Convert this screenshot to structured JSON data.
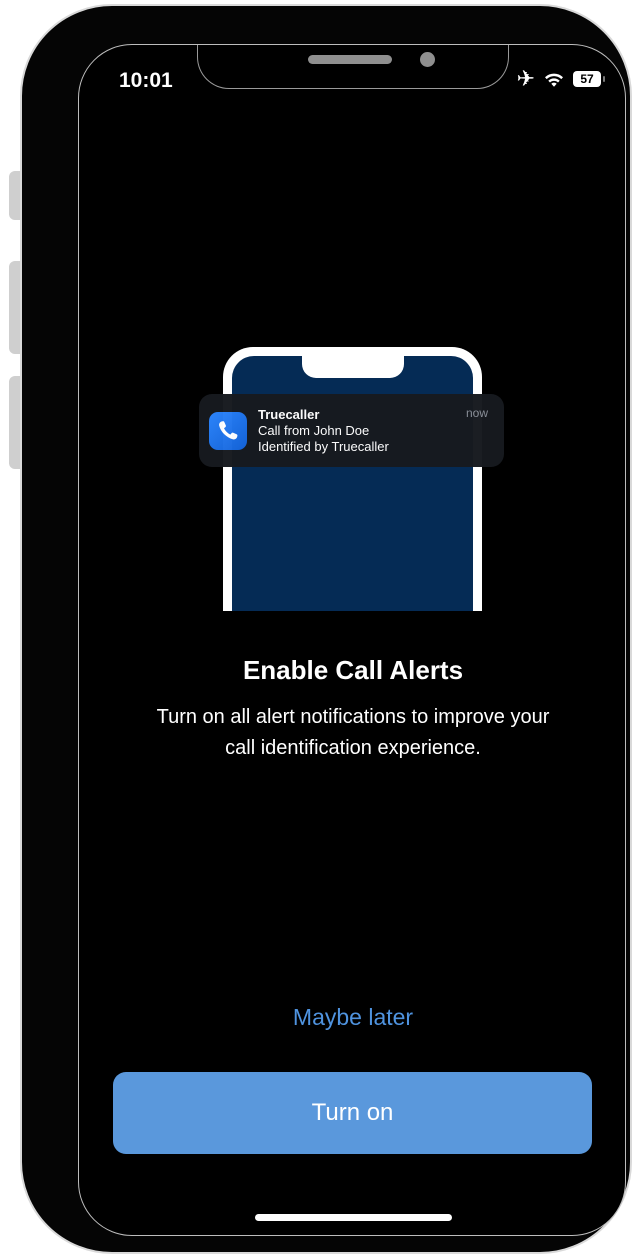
{
  "status_bar": {
    "time": "10:01",
    "battery_level": "57",
    "icons": [
      "airplane-icon",
      "wifi-icon",
      "battery-icon"
    ]
  },
  "illustration": {
    "notification": {
      "app_name": "Truecaller",
      "line1": "Call from John Doe",
      "line2": "Identified by Truecaller",
      "time": "now",
      "icon": "phone-icon"
    }
  },
  "main": {
    "title": "Enable Call Alerts",
    "description": "Turn on all alert notifications to improve your call identification experience."
  },
  "actions": {
    "maybe_later": "Maybe later",
    "turn_on": "Turn on"
  },
  "colors": {
    "accent": "#4f93df",
    "button_bg": "#5a98dc",
    "screen_bg": "#000000",
    "illustration_screen": "#052b55"
  }
}
